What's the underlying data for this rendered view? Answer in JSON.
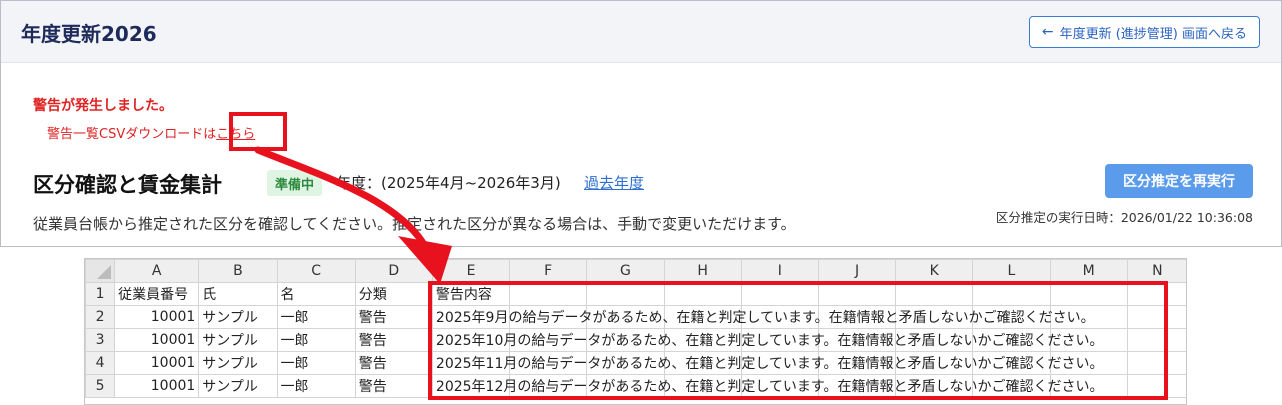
{
  "app": {
    "title": "年度更新2026",
    "back_button": "年度更新 (進捗管理) 画面へ戻る",
    "warning": {
      "title": "警告が発生しました。",
      "csv_text": "警告一覧CSVダウンロードは",
      "csv_link": "こちら"
    },
    "section": {
      "title": "区分確認と賃金集計",
      "badge": "準備中",
      "period": "年度：(2025年4月~2026年3月)",
      "past_link": "過去年度",
      "rerun_button": "区分推定を再実行",
      "exec_date": "区分推定の実行日時：2026/01/22 10:36:08",
      "description": "従業員台帳から推定された区分を確認してください。推定された区分が異なる場合は、手動で変更いただけます。"
    }
  },
  "colors": {
    "accent": "#2d6fd1",
    "warning": "#e02222",
    "highlight": "#e8121f",
    "button": "#5b9bec",
    "badge_bg": "#dff4e2"
  },
  "sheet": {
    "columns": [
      "A",
      "B",
      "C",
      "D",
      "E",
      "F",
      "G",
      "H",
      "I",
      "J",
      "K",
      "L",
      "M",
      "N"
    ],
    "rows": [
      {
        "n": "1",
        "a": "従業員番号",
        "b": "氏",
        "c": "名",
        "d": "分類",
        "e": "警告内容"
      },
      {
        "n": "2",
        "a": "10001",
        "b": "サンプル",
        "c": "一郎",
        "d": "警告",
        "e": "2025年9月の給与データがあるため、在籍と判定しています。在籍情報と矛盾しないかご確認ください。"
      },
      {
        "n": "3",
        "a": "10001",
        "b": "サンプル",
        "c": "一郎",
        "d": "警告",
        "e": "2025年10月の給与データがあるため、在籍と判定しています。在籍情報と矛盾しないかご確認ください。"
      },
      {
        "n": "4",
        "a": "10001",
        "b": "サンプル",
        "c": "一郎",
        "d": "警告",
        "e": "2025年11月の給与データがあるため、在籍と判定しています。在籍情報と矛盾しないかご確認ください。"
      },
      {
        "n": "5",
        "a": "10001",
        "b": "サンプル",
        "c": "一郎",
        "d": "警告",
        "e": "2025年12月の給与データがあるため、在籍と判定しています。在籍情報と矛盾しないかご確認ください。"
      }
    ]
  }
}
